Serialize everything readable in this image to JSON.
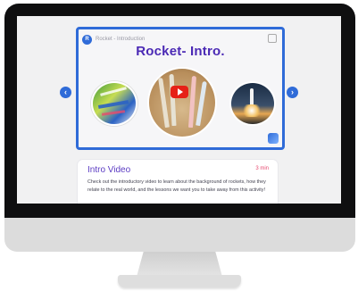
{
  "video": {
    "channel_initial": "R",
    "label": "Rocket - Introduction",
    "title": "Rocket- Intro."
  },
  "icons": {
    "prev": "chevron-left-icon",
    "next": "chevron-right-icon",
    "play": "play-icon",
    "copy": "copy-icon"
  },
  "nav": {
    "prev_glyph": "‹",
    "next_glyph": "›"
  },
  "card": {
    "title": "Intro Video",
    "duration": "3 min",
    "description": "Check out the introductory video to learn about the background of rockets, how they relate to the real world, and the lessons we want you to take away from this activity!"
  },
  "colors": {
    "accent": "#2f6bd8",
    "title": "#4b2ab5",
    "duration": "#e74a70",
    "play": "#e62117"
  }
}
